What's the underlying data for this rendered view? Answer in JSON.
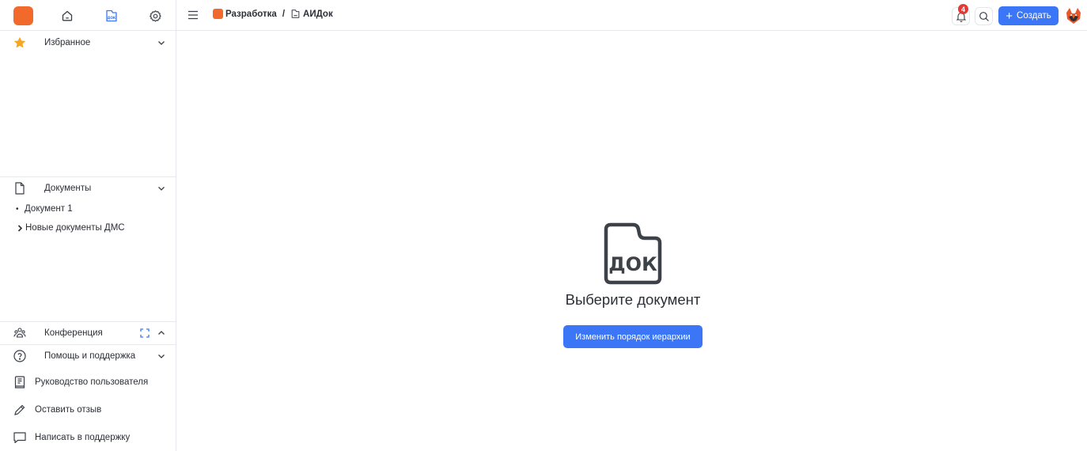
{
  "colors": {
    "brand": "#f26a2b",
    "accent": "#3b76f6",
    "badge": "#e53935",
    "star": "#f5a623"
  },
  "header": {
    "breadcrumb": [
      {
        "label": "Разработка",
        "icon": "project-square-icon"
      },
      {
        "label": "АИДок",
        "icon": "doc-app-icon"
      }
    ],
    "breadcrumb_separator": "/",
    "notifications_count": "4",
    "create_label": "Создать"
  },
  "sidebar": {
    "top_icons": [
      "app-logo",
      "home-icon",
      "doc-app-icon",
      "settings-icon"
    ],
    "favorites": {
      "label": "Избранное",
      "icon": "star-icon"
    },
    "documents": {
      "label": "Документы",
      "icon": "document-icon",
      "items": [
        {
          "label": "Документ 1",
          "type": "document"
        },
        {
          "label": "Новые документы ДМС",
          "type": "folder"
        }
      ]
    },
    "conference": {
      "label": "Конференция",
      "icon": "people-icon"
    },
    "help": {
      "label": "Помощь и поддержка",
      "icon": "help-circle-icon",
      "items": [
        {
          "label": "Руководство пользователя",
          "icon": "manual-icon"
        },
        {
          "label": "Оставить отзыв",
          "icon": "pencil-icon"
        },
        {
          "label": "Написать в поддержку",
          "icon": "chat-icon"
        }
      ]
    }
  },
  "main": {
    "empty_icon_text": "ДОК",
    "empty_title": "Выберите документ",
    "reorder_button": "Изменить порядок иерархии"
  }
}
